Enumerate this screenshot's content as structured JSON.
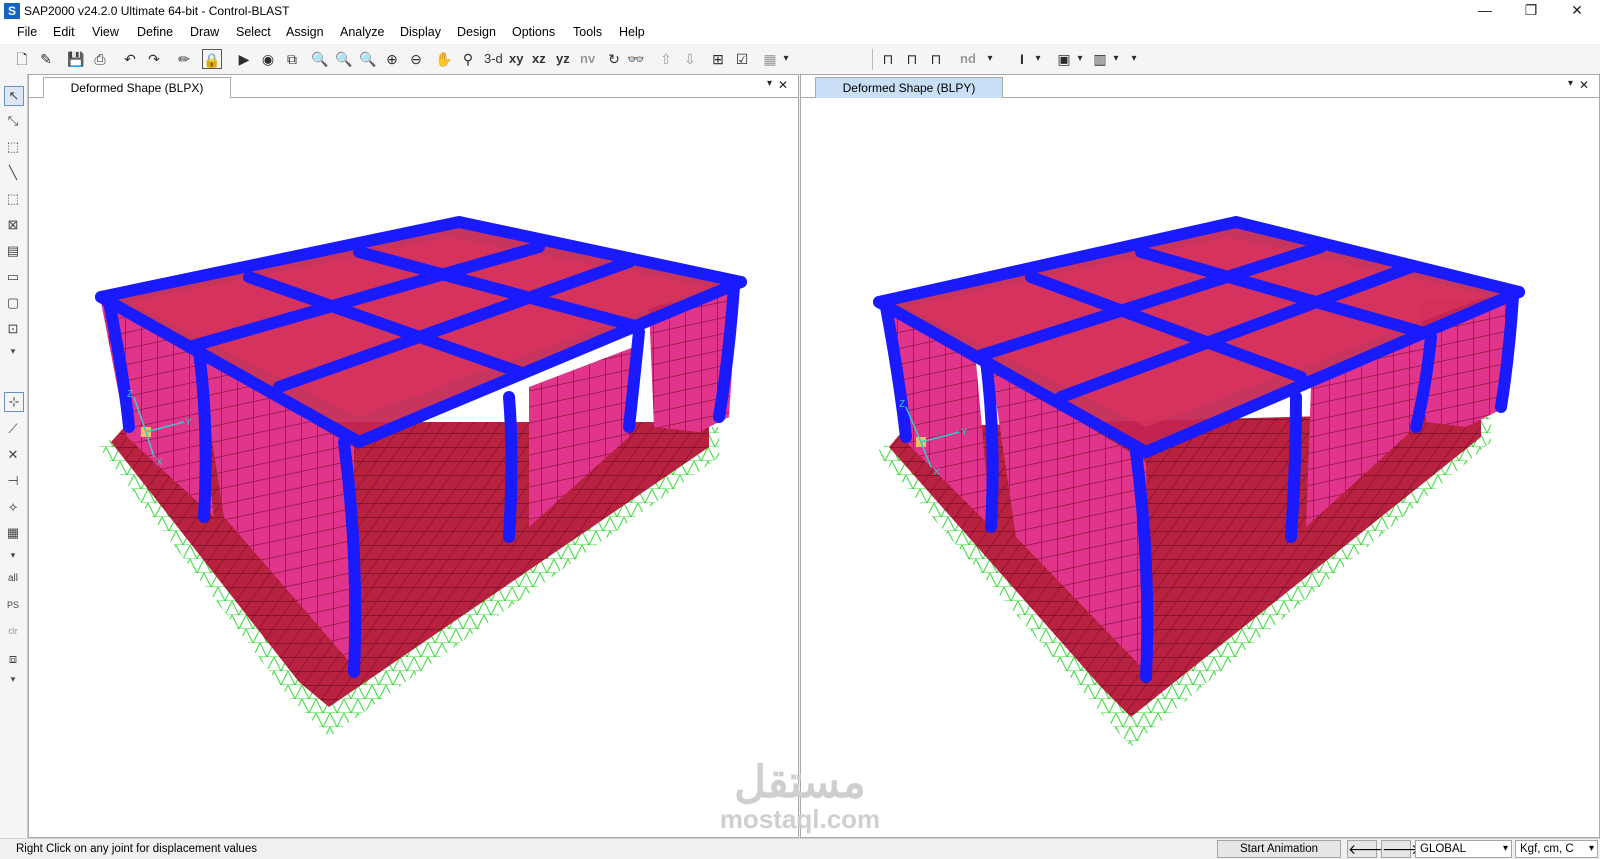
{
  "window": {
    "title": "SAP2000 v24.2.0 Ultimate 64-bit - Control-BLAST",
    "app_icon": "S",
    "minimize": "—",
    "restore": "❐",
    "close": "✕"
  },
  "menu": [
    "File",
    "Edit",
    "View",
    "Define",
    "Draw",
    "Select",
    "Assign",
    "Analyze",
    "Display",
    "Design",
    "Options",
    "Tools",
    "Help"
  ],
  "toolbar": {
    "view_3d": "3-d",
    "view_xy": "xy",
    "view_xz": "xz",
    "view_yz": "yz",
    "view_nv": "nv",
    "view_nd": "nd"
  },
  "panes": [
    {
      "tab": "Deformed Shape (BLPX)",
      "active": false
    },
    {
      "tab": "Deformed Shape (BLPY)",
      "active": true
    }
  ],
  "pane_controls": {
    "dropdown": "▾",
    "close": "✕"
  },
  "left_toolbar": {
    "all": "all",
    "ps": "PS",
    "clr": "clr"
  },
  "axes": {
    "x": "X",
    "y": "Y",
    "z": "Z"
  },
  "status": {
    "message": "Right Click on any joint for displacement values",
    "start_animation": "Start Animation",
    "coord_system": "GLOBAL",
    "units": "Kgf, cm, C"
  },
  "watermark": {
    "arabic": "مستقل",
    "latin": "mostaql.com"
  },
  "colors": {
    "frame": "#1a1aff",
    "shell": "#d9245a",
    "slab": "#b01e3c",
    "support": "#33cc33",
    "active_tab": "#c9dff5"
  }
}
